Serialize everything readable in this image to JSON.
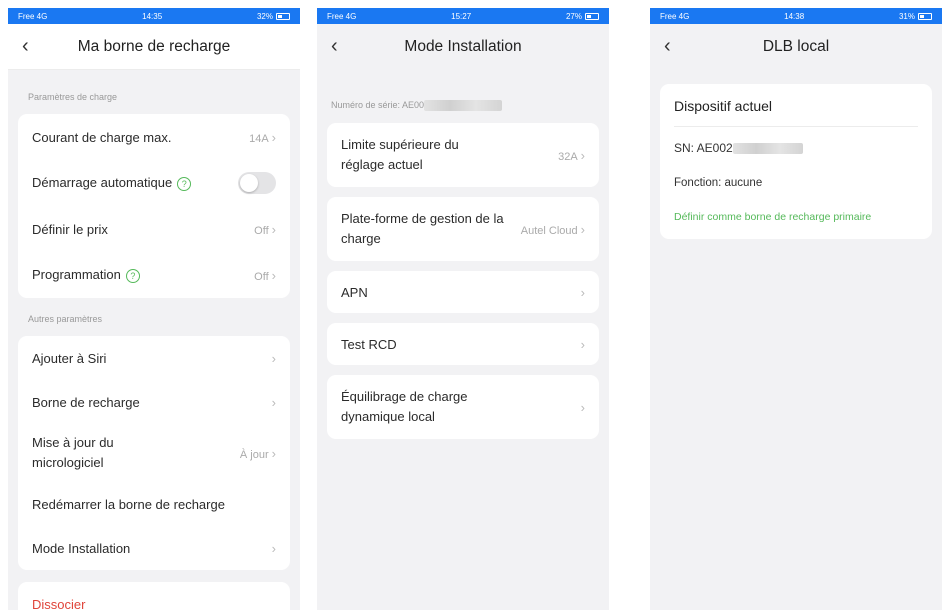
{
  "screen1": {
    "status": {
      "carrier": "Free 4G",
      "time": "14:35",
      "battery": "32%"
    },
    "title": "Ma borne de recharge",
    "section_charge": "Paramètres de charge",
    "rows_charge": [
      {
        "label": "Courant de charge max.",
        "value": "14A"
      },
      {
        "label": "Démarrage automatique",
        "value": ""
      },
      {
        "label": "Définir le prix",
        "value": "Off"
      },
      {
        "label": "Programmation",
        "value": "Off"
      }
    ],
    "section_other": "Autres paramètres",
    "rows_other": [
      {
        "label": "Ajouter à Siri",
        "value": ""
      },
      {
        "label": "Borne de recharge",
        "value": ""
      },
      {
        "label": "Mise à jour du micrologiciel",
        "value": "À jour"
      },
      {
        "label": "Redémarrer la borne de recharge",
        "value": ""
      },
      {
        "label": "Mode Installation",
        "value": ""
      }
    ],
    "dissociate": "Dissocier",
    "toggle_on": false
  },
  "screen2": {
    "status": {
      "carrier": "Free 4G",
      "time": "15:27",
      "battery": "27%"
    },
    "title": "Mode Installation",
    "serial_label": "Numéro de série: AE00",
    "rows": [
      {
        "label": "Limite supérieure du réglage actuel",
        "value": "32A"
      },
      {
        "label": "Plate-forme de gestion de la charge",
        "value": "Autel Cloud"
      },
      {
        "label": "APN",
        "value": ""
      },
      {
        "label": "Test RCD",
        "value": ""
      },
      {
        "label": "Équilibrage de charge dynamique local",
        "value": ""
      }
    ]
  },
  "screen3": {
    "status": {
      "carrier": "Free 4G",
      "time": "14:38",
      "battery": "31%"
    },
    "title": "DLB local",
    "card_title": "Dispositif actuel",
    "sn": "SN: AE002",
    "fonction": "Fonction: aucune",
    "link": "Définir comme borne de recharge primaire"
  },
  "colors": {
    "status_bar": "#1a78f2",
    "accent_green": "#55b95a",
    "danger": "#e0443a"
  },
  "icons": [
    "back-chevron-icon",
    "chevron-right-icon",
    "help-circle-icon",
    "signal-icon",
    "battery-icon",
    "location-icon"
  ]
}
